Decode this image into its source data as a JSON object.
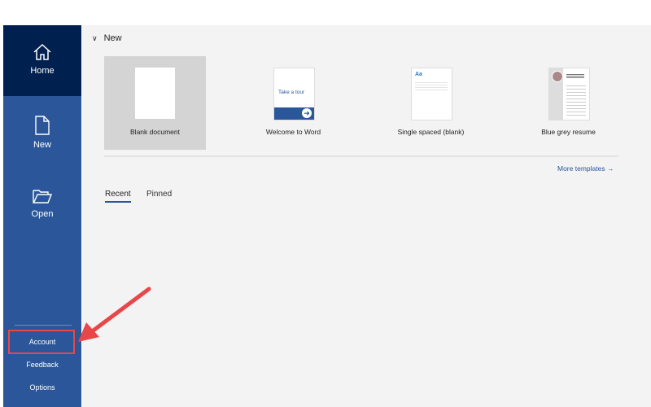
{
  "sidebar": {
    "items": [
      {
        "label": "Home",
        "icon": "home-icon"
      },
      {
        "label": "New",
        "icon": "new-document-icon"
      },
      {
        "label": "Open",
        "icon": "folder-open-icon"
      }
    ],
    "bottom": [
      {
        "label": "Account"
      },
      {
        "label": "Feedback"
      },
      {
        "label": "Options"
      }
    ]
  },
  "main": {
    "new_heading": "New",
    "templates": [
      {
        "label": "Blank document"
      },
      {
        "label": "Welcome to Word",
        "thumb_text": "Take a tour"
      },
      {
        "label": "Single spaced (blank)",
        "thumb_text": "Aa"
      },
      {
        "label": "Blue grey resume"
      }
    ],
    "more_templates": "More templates →",
    "tabs": [
      {
        "label": "Recent"
      },
      {
        "label": "Pinned"
      }
    ]
  },
  "colors": {
    "sidebar": "#2b579a",
    "sidebar_active": "#002050",
    "annotation": "#e8474a"
  }
}
